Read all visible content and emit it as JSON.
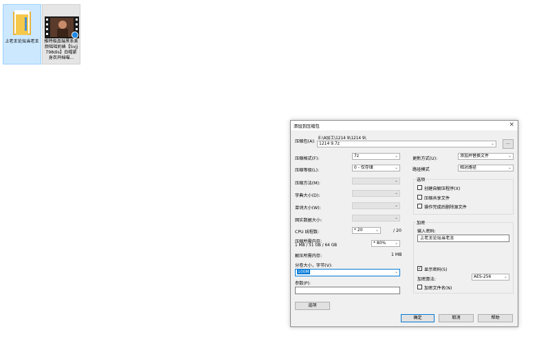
{
  "desktop": {
    "icons": [
      {
        "label": "上老王论坛当老王",
        "type": "folder"
      },
      {
        "label": "推特极品瑞黑系美颜瑶瑶奶婊【Svjj798dis】白帽紧身衣开档喵...",
        "type": "video"
      }
    ]
  },
  "dialog": {
    "title": "添加到压缩包",
    "close": "×",
    "archive_label": "压缩包(A):",
    "archive_path": "E:\\A加工\\1214 9\\1214 9\\",
    "archive_name": "1214 9.7z",
    "browse_label": "...",
    "format_label": "压缩格式(F):",
    "format_value": "7z",
    "level_label": "压缩等级(L):",
    "level_value": "0 - 仅存储",
    "method_label": "压缩方法(M):",
    "dict_label": "字典大小(D):",
    "word_label": "单词大小(W):",
    "solid_label": "固实数据大小:",
    "cpu_label": "CPU 线程数:",
    "cpu_value": "* 20",
    "cpu_total": "/ 20",
    "mem_label": "压缩所需内存:",
    "mem_detail": "1 MB / 51 GB / 64 GB",
    "mem_value": "* 80%",
    "decomp_label": "解压所需内存:",
    "decomp_value": "1 MB",
    "split_label": "分卷大小，字节(V):",
    "split_value": "100M",
    "params_label": "参数(P):",
    "params_value": "",
    "options_button": "选项",
    "update_label": "更新方式(U):",
    "update_value": "添加并替换文件",
    "path_label": "路径模式",
    "path_value": "相对路径",
    "options_group": "选项",
    "opt_sfx": "创建自解压程序(X)",
    "opt_shared": "压缩共享文件",
    "opt_delete": "操作完成后删除源文件",
    "encrypt_group": "加密",
    "password_label": "输入密码:",
    "password_value": "上老王论坛当老王",
    "show_password": "显示密码(S)",
    "enc_method_label": "加密算法:",
    "enc_method_value": "AES-256",
    "encrypt_names": "加密文件名(N)",
    "ok": "确定",
    "cancel": "取消",
    "help": "帮助"
  }
}
